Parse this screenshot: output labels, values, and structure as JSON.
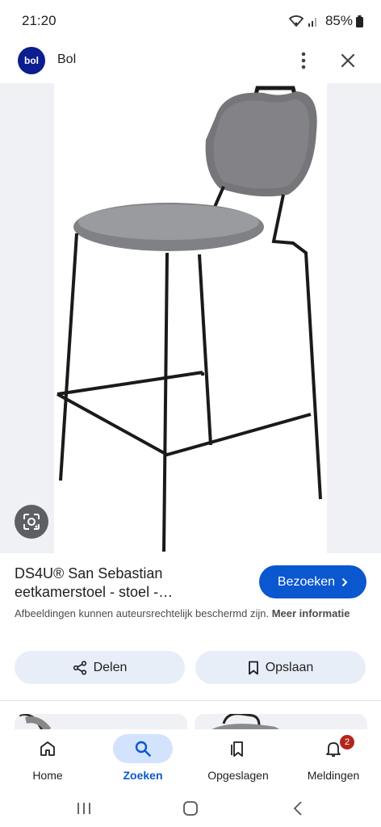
{
  "status_bar": {
    "time": "21:20",
    "battery": "85%"
  },
  "header": {
    "logo_text": "bol",
    "site_name": "Bol"
  },
  "result": {
    "title": "DS4U® San Sebastian eetkamerstoel - stoel -…",
    "visit_label": "Bezoeken",
    "copyright_text": "Afbeeldingen kunnen auteursrechtelijk beschermd zijn.",
    "more_info_label": "Meer informatie"
  },
  "actions": {
    "share_label": "Delen",
    "save_label": "Opslaan"
  },
  "bottom_nav": {
    "items": [
      {
        "label": "Home",
        "icon": "home-icon"
      },
      {
        "label": "Zoeken",
        "icon": "search-icon",
        "active": true
      },
      {
        "label": "Opgeslagen",
        "icon": "bookmarks-icon"
      },
      {
        "label": "Meldingen",
        "icon": "bell-icon",
        "badge": "2"
      }
    ]
  },
  "colors": {
    "accent": "#0b57d0",
    "badge": "#b3261e",
    "chip_bg": "#e8eef8",
    "image_bg": "#f0f1f4"
  }
}
